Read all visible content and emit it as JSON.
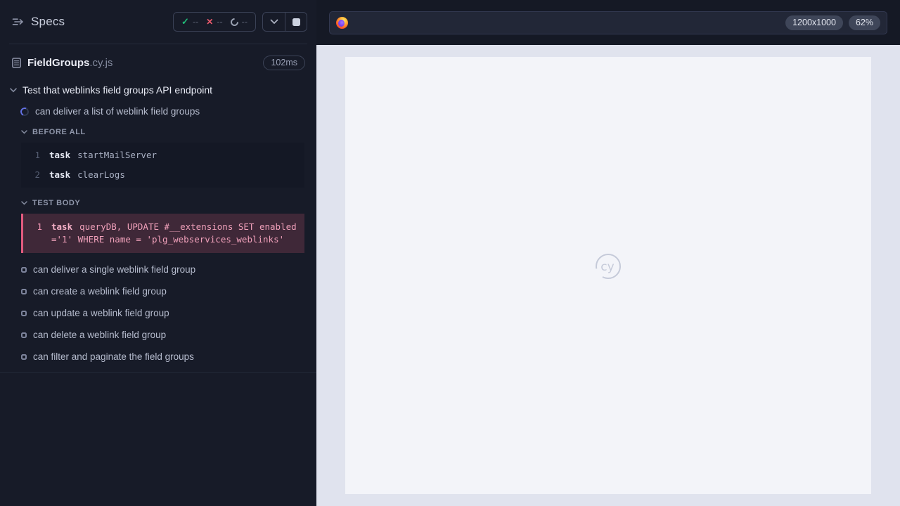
{
  "sidebar": {
    "title": "Specs",
    "stats": {
      "passed": "--",
      "failed": "--",
      "running": "--"
    },
    "spec": {
      "name": "FieldGroups",
      "ext": ".cy.js",
      "duration": "102ms"
    },
    "suite": {
      "title": "Test that weblinks field groups API endpoint",
      "running_test": "can deliver a list of weblink field groups",
      "hooks": [
        {
          "label": "BEFORE ALL",
          "commands": [
            {
              "number": "1",
              "method": "task",
              "message": "startMailServer"
            },
            {
              "number": "2",
              "method": "task",
              "message": "clearLogs"
            }
          ]
        },
        {
          "label": "TEST BODY",
          "commands": [
            {
              "number": "1",
              "method": "task",
              "message": "queryDB, UPDATE #__extensions SET enabled ='1' WHERE name = 'plg_webservices_weblinks'"
            }
          ]
        }
      ],
      "pending": [
        "can deliver a single weblink field group",
        "can create a weblink field group",
        "can update a weblink field group",
        "can delete a weblink field group",
        "can filter and paginate the field groups"
      ]
    }
  },
  "icons": {
    "check": "✓",
    "cross": "✕"
  },
  "header": {
    "viewport": "1200x1000",
    "zoom": "62%"
  },
  "aut": {
    "watermark": "cy"
  },
  "colors": {
    "sidebar_bg": "#171b28",
    "command_bg": "#141825",
    "highlight_bg": "#3f2838",
    "highlight_border": "#e25a7e",
    "highlight_text": "#f0a0ba",
    "passed_green": "#21b978",
    "failed_red": "#ec5a6d",
    "spinner_blue": "#6371e4",
    "runner_header_bg": "#151925",
    "aut_area_bg": "#e0e3ee",
    "aut_frame_bg": "#f3f4f9"
  }
}
